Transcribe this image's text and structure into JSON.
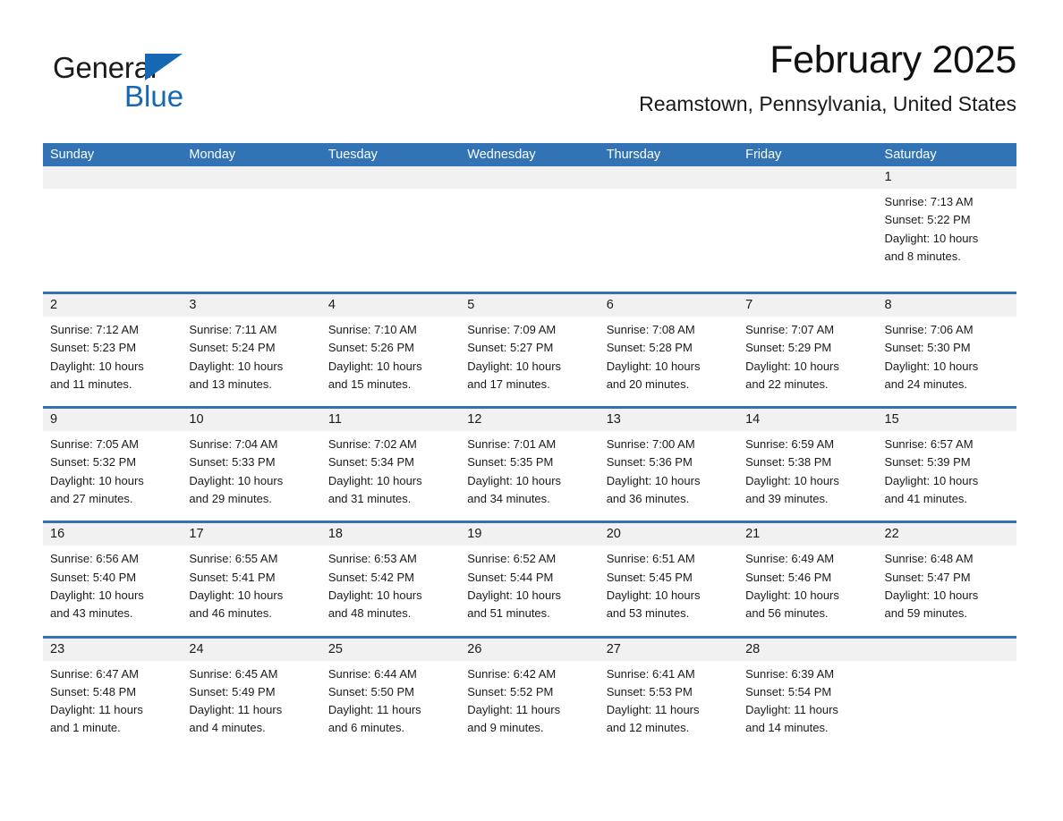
{
  "brand": {
    "name_part1": "General",
    "name_part2": "Blue",
    "accent_color": "#1668b3"
  },
  "header": {
    "title": "February 2025",
    "subtitle": "Reamstown, Pennsylvania, United States",
    "header_bg_color": "#3173b5",
    "daynum_bg_color": "#f1f1f1"
  },
  "weekday_headers": [
    "Sunday",
    "Monday",
    "Tuesday",
    "Wednesday",
    "Thursday",
    "Friday",
    "Saturday"
  ],
  "labels": {
    "sunrise_prefix": "Sunrise:",
    "sunset_prefix": "Sunset:",
    "daylight_prefix": "Daylight:"
  },
  "weeks": [
    {
      "days": [
        {
          "num": "",
          "empty": true
        },
        {
          "num": "",
          "empty": true
        },
        {
          "num": "",
          "empty": true
        },
        {
          "num": "",
          "empty": true
        },
        {
          "num": "",
          "empty": true
        },
        {
          "num": "",
          "empty": true
        },
        {
          "num": "1",
          "empty": false,
          "sunrise": "Sunrise: 7:13 AM",
          "sunset": "Sunset: 5:22 PM",
          "daylight_l1": "Daylight: 10 hours",
          "daylight_l2": "and 8 minutes."
        }
      ]
    },
    {
      "days": [
        {
          "num": "2",
          "empty": false,
          "sunrise": "Sunrise: 7:12 AM",
          "sunset": "Sunset: 5:23 PM",
          "daylight_l1": "Daylight: 10 hours",
          "daylight_l2": "and 11 minutes."
        },
        {
          "num": "3",
          "empty": false,
          "sunrise": "Sunrise: 7:11 AM",
          "sunset": "Sunset: 5:24 PM",
          "daylight_l1": "Daylight: 10 hours",
          "daylight_l2": "and 13 minutes."
        },
        {
          "num": "4",
          "empty": false,
          "sunrise": "Sunrise: 7:10 AM",
          "sunset": "Sunset: 5:26 PM",
          "daylight_l1": "Daylight: 10 hours",
          "daylight_l2": "and 15 minutes."
        },
        {
          "num": "5",
          "empty": false,
          "sunrise": "Sunrise: 7:09 AM",
          "sunset": "Sunset: 5:27 PM",
          "daylight_l1": "Daylight: 10 hours",
          "daylight_l2": "and 17 minutes."
        },
        {
          "num": "6",
          "empty": false,
          "sunrise": "Sunrise: 7:08 AM",
          "sunset": "Sunset: 5:28 PM",
          "daylight_l1": "Daylight: 10 hours",
          "daylight_l2": "and 20 minutes."
        },
        {
          "num": "7",
          "empty": false,
          "sunrise": "Sunrise: 7:07 AM",
          "sunset": "Sunset: 5:29 PM",
          "daylight_l1": "Daylight: 10 hours",
          "daylight_l2": "and 22 minutes."
        },
        {
          "num": "8",
          "empty": false,
          "sunrise": "Sunrise: 7:06 AM",
          "sunset": "Sunset: 5:30 PM",
          "daylight_l1": "Daylight: 10 hours",
          "daylight_l2": "and 24 minutes."
        }
      ]
    },
    {
      "days": [
        {
          "num": "9",
          "empty": false,
          "sunrise": "Sunrise: 7:05 AM",
          "sunset": "Sunset: 5:32 PM",
          "daylight_l1": "Daylight: 10 hours",
          "daylight_l2": "and 27 minutes."
        },
        {
          "num": "10",
          "empty": false,
          "sunrise": "Sunrise: 7:04 AM",
          "sunset": "Sunset: 5:33 PM",
          "daylight_l1": "Daylight: 10 hours",
          "daylight_l2": "and 29 minutes."
        },
        {
          "num": "11",
          "empty": false,
          "sunrise": "Sunrise: 7:02 AM",
          "sunset": "Sunset: 5:34 PM",
          "daylight_l1": "Daylight: 10 hours",
          "daylight_l2": "and 31 minutes."
        },
        {
          "num": "12",
          "empty": false,
          "sunrise": "Sunrise: 7:01 AM",
          "sunset": "Sunset: 5:35 PM",
          "daylight_l1": "Daylight: 10 hours",
          "daylight_l2": "and 34 minutes."
        },
        {
          "num": "13",
          "empty": false,
          "sunrise": "Sunrise: 7:00 AM",
          "sunset": "Sunset: 5:36 PM",
          "daylight_l1": "Daylight: 10 hours",
          "daylight_l2": "and 36 minutes."
        },
        {
          "num": "14",
          "empty": false,
          "sunrise": "Sunrise: 6:59 AM",
          "sunset": "Sunset: 5:38 PM",
          "daylight_l1": "Daylight: 10 hours",
          "daylight_l2": "and 39 minutes."
        },
        {
          "num": "15",
          "empty": false,
          "sunrise": "Sunrise: 6:57 AM",
          "sunset": "Sunset: 5:39 PM",
          "daylight_l1": "Daylight: 10 hours",
          "daylight_l2": "and 41 minutes."
        }
      ]
    },
    {
      "days": [
        {
          "num": "16",
          "empty": false,
          "sunrise": "Sunrise: 6:56 AM",
          "sunset": "Sunset: 5:40 PM",
          "daylight_l1": "Daylight: 10 hours",
          "daylight_l2": "and 43 minutes."
        },
        {
          "num": "17",
          "empty": false,
          "sunrise": "Sunrise: 6:55 AM",
          "sunset": "Sunset: 5:41 PM",
          "daylight_l1": "Daylight: 10 hours",
          "daylight_l2": "and 46 minutes."
        },
        {
          "num": "18",
          "empty": false,
          "sunrise": "Sunrise: 6:53 AM",
          "sunset": "Sunset: 5:42 PM",
          "daylight_l1": "Daylight: 10 hours",
          "daylight_l2": "and 48 minutes."
        },
        {
          "num": "19",
          "empty": false,
          "sunrise": "Sunrise: 6:52 AM",
          "sunset": "Sunset: 5:44 PM",
          "daylight_l1": "Daylight: 10 hours",
          "daylight_l2": "and 51 minutes."
        },
        {
          "num": "20",
          "empty": false,
          "sunrise": "Sunrise: 6:51 AM",
          "sunset": "Sunset: 5:45 PM",
          "daylight_l1": "Daylight: 10 hours",
          "daylight_l2": "and 53 minutes."
        },
        {
          "num": "21",
          "empty": false,
          "sunrise": "Sunrise: 6:49 AM",
          "sunset": "Sunset: 5:46 PM",
          "daylight_l1": "Daylight: 10 hours",
          "daylight_l2": "and 56 minutes."
        },
        {
          "num": "22",
          "empty": false,
          "sunrise": "Sunrise: 6:48 AM",
          "sunset": "Sunset: 5:47 PM",
          "daylight_l1": "Daylight: 10 hours",
          "daylight_l2": "and 59 minutes."
        }
      ]
    },
    {
      "days": [
        {
          "num": "23",
          "empty": false,
          "sunrise": "Sunrise: 6:47 AM",
          "sunset": "Sunset: 5:48 PM",
          "daylight_l1": "Daylight: 11 hours",
          "daylight_l2": "and 1 minute."
        },
        {
          "num": "24",
          "empty": false,
          "sunrise": "Sunrise: 6:45 AM",
          "sunset": "Sunset: 5:49 PM",
          "daylight_l1": "Daylight: 11 hours",
          "daylight_l2": "and 4 minutes."
        },
        {
          "num": "25",
          "empty": false,
          "sunrise": "Sunrise: 6:44 AM",
          "sunset": "Sunset: 5:50 PM",
          "daylight_l1": "Daylight: 11 hours",
          "daylight_l2": "and 6 minutes."
        },
        {
          "num": "26",
          "empty": false,
          "sunrise": "Sunrise: 6:42 AM",
          "sunset": "Sunset: 5:52 PM",
          "daylight_l1": "Daylight: 11 hours",
          "daylight_l2": "and 9 minutes."
        },
        {
          "num": "27",
          "empty": false,
          "sunrise": "Sunrise: 6:41 AM",
          "sunset": "Sunset: 5:53 PM",
          "daylight_l1": "Daylight: 11 hours",
          "daylight_l2": "and 12 minutes."
        },
        {
          "num": "28",
          "empty": false,
          "sunrise": "Sunrise: 6:39 AM",
          "sunset": "Sunset: 5:54 PM",
          "daylight_l1": "Daylight: 11 hours",
          "daylight_l2": "and 14 minutes."
        },
        {
          "num": "",
          "empty": true
        }
      ]
    }
  ]
}
